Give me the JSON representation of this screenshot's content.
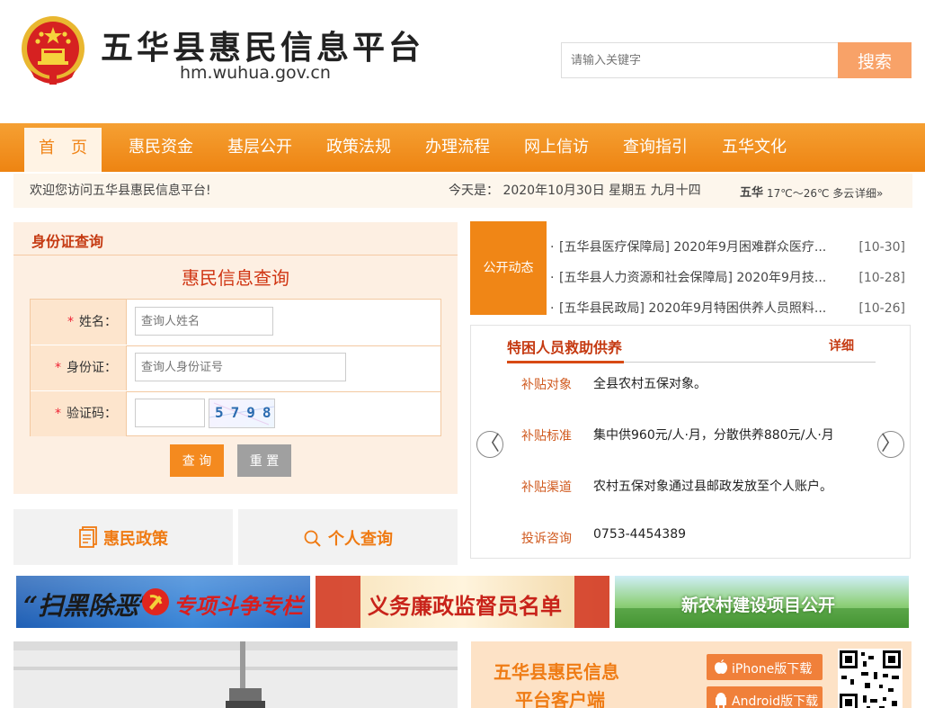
{
  "header": {
    "site_title": "五华县惠民信息平台",
    "site_url": "hm.wuhua.gov.cn",
    "search_placeholder": "请输入关键字",
    "search_button": "搜索"
  },
  "nav": {
    "items": [
      "首　页",
      "惠民资金",
      "基层公开",
      "政策法规",
      "办理流程",
      "网上信访",
      "查询指引",
      "五华文化"
    ],
    "active_index": 0
  },
  "welcome_bar": {
    "welcome": "欢迎您访问五华县惠民信息平台!",
    "date_text": "今天是： 2020年10月30日 星期五  九月十四",
    "weather_city": "五华",
    "weather_info": "17℃～26℃ 多云",
    "weather_link": "详细»"
  },
  "id_query": {
    "panel_title": "身份证查询",
    "heading": "惠民信息查询",
    "required_mark": "*",
    "name_label": "姓名：",
    "name_placeholder": "查询人姓名",
    "id_label": "身份证：",
    "id_placeholder": "查询人身份证号",
    "captcha_label": "验证码：",
    "captcha_text": "5798",
    "query_button": "查 询",
    "reset_button": "重 置"
  },
  "quick_links": {
    "policy": "惠民政策",
    "personal_query": "个人查询"
  },
  "news": {
    "tag": "公开动态",
    "items": [
      {
        "text": "[五华县医疗保障局] 2020年9月困难群众医疗...",
        "date": "[10-30]"
      },
      {
        "text": "[五华县人力资源和社会保障局] 2020年9月技...",
        "date": "[10-28]"
      },
      {
        "text": "[五华县民政局] 2020年9月特困供养人员照料...",
        "date": "[10-26]"
      }
    ]
  },
  "support": {
    "title": "特困人员救助供养",
    "more": "详细",
    "rows": [
      {
        "label": "补贴对象",
        "value": "全县农村五保对象。"
      },
      {
        "label": "补贴标准",
        "value": "集中供960元/人·月，分散供养880元/人·月"
      },
      {
        "label": "补贴渠道",
        "value": "农村五保对象通过县邮政发放至个人账户。"
      },
      {
        "label": "投诉咨询",
        "value": "0753-4454389"
      }
    ]
  },
  "banners": {
    "b1_part1": "“扫黑除恶”",
    "b1_part2": "专项斗争专栏",
    "b2": "义务廉政监督员名单",
    "b3": "新农村建设项目公开"
  },
  "app": {
    "title_line1": "五华县惠民信息",
    "title_line2": "平台客户端",
    "iphone": "iPhone版下载",
    "android": "Android版下载"
  },
  "colors": {
    "nav_orange": "#f39221",
    "accent_red": "#c53a12",
    "search_button": "#f8a268"
  }
}
